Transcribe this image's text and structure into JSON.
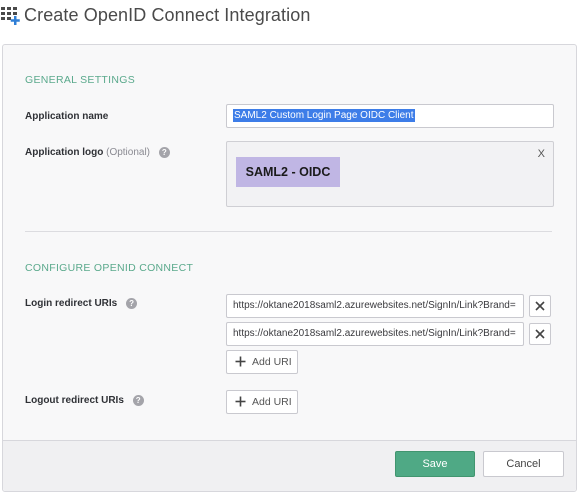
{
  "header": {
    "title": "Create OpenID Connect Integration",
    "icon": "app-grid-add-icon"
  },
  "general": {
    "title": "GENERAL SETTINGS",
    "app_name_label": "Application name",
    "app_name_value": "SAML2 Custom Login Page OIDC Client",
    "app_logo_label": "Application logo",
    "app_logo_optional": "(Optional)",
    "logo_text": "SAML2 - OIDC",
    "logo_remove": "X"
  },
  "oidc": {
    "title": "CONFIGURE OPENID CONNECT",
    "login_label": "Login redirect URIs",
    "login_uris": [
      "https://oktane2018saml2.azurewebsites.net/SignIn/Link?Brand=",
      "https://oktane2018saml2.azurewebsites.net/SignIn/Link?Brand="
    ],
    "add_uri_label": "Add URI",
    "logout_label": "Logout redirect URIs"
  },
  "footer": {
    "save_label": "Save",
    "cancel_label": "Cancel"
  },
  "colors": {
    "accent": "#4fa985",
    "section_title": "#5aa98c",
    "logo_bg": "#c0b6e4",
    "selection": "#3d7de8"
  }
}
